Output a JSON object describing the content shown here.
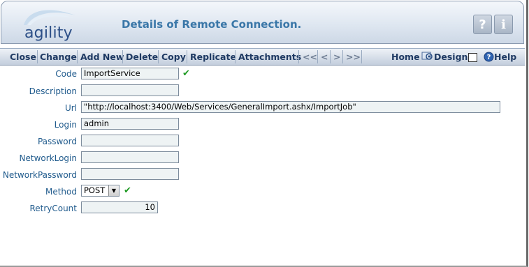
{
  "header": {
    "logo_text": "agility",
    "title": "Details of Remote Connection.",
    "help_icon_glyph": "?",
    "info_icon_glyph": "i"
  },
  "toolbar": {
    "close": "Close",
    "change": "Change",
    "add_new": "Add New",
    "delete": "Delete",
    "copy": "Copy",
    "replicate": "Replicate",
    "attachments": "Attachments",
    "first": "<<",
    "prev": "<",
    "next": ">",
    "last": ">>",
    "home": "Home",
    "design": "Design",
    "help": "Help"
  },
  "form": {
    "code": {
      "label": "Code",
      "value": "ImportService"
    },
    "description": {
      "label": "Description",
      "value": ""
    },
    "url": {
      "label": "Url",
      "value": "\"http://localhost:3400/Web/Services/GeneralImport.ashx/ImportJob\""
    },
    "login": {
      "label": "Login",
      "value": "admin"
    },
    "password": {
      "label": "Password",
      "value": ""
    },
    "network_login": {
      "label": "NetworkLogin",
      "value": ""
    },
    "network_password": {
      "label": "NetworkPassword",
      "value": ""
    },
    "method": {
      "label": "Method",
      "value": "POST"
    },
    "retry_count": {
      "label": "RetryCount",
      "value": "10"
    },
    "check_glyph": "✔"
  },
  "colors": {
    "title": "#3a77a8",
    "label": "#1f5a8c",
    "toolbar_text": "#1f3a63",
    "checkmark": "#1f9a23",
    "input_bg": "#eef3f4"
  }
}
